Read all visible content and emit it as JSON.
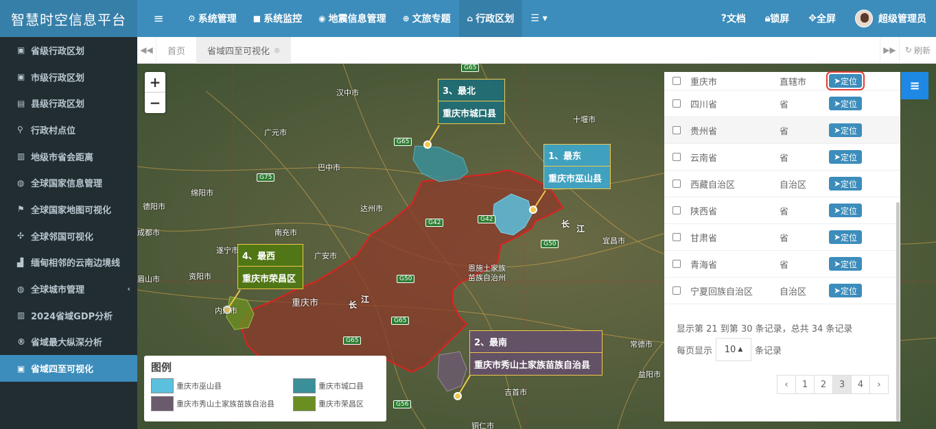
{
  "app": {
    "title": "智慧时空信息平台"
  },
  "topnav": {
    "menu_icon": "hamburger-icon",
    "items": [
      {
        "label": "系统管理",
        "icon": "gear-icon"
      },
      {
        "label": "系统监控",
        "icon": "video-icon"
      },
      {
        "label": "地震信息管理",
        "icon": "location-icon"
      },
      {
        "label": "文旅专题",
        "icon": "globe-icon"
      },
      {
        "label": "行政区划",
        "icon": "bank-icon"
      }
    ],
    "more_icon": "list-icon"
  },
  "topright": {
    "docs": "文档",
    "lock": "锁屏",
    "fullscreen": "全屏",
    "user": "超级管理员"
  },
  "sidebar": {
    "items": [
      {
        "label": "省级行政区划",
        "icon": "map-frame-icon"
      },
      {
        "label": "市级行政区划",
        "icon": "map-frame-icon"
      },
      {
        "label": "县级行政区划",
        "icon": "map-icon"
      },
      {
        "label": "行政村点位",
        "icon": "pin-icon"
      },
      {
        "label": "地级市省会距离",
        "icon": "bar-chart-icon"
      },
      {
        "label": "全球国家信息管理",
        "icon": "globe-icon"
      },
      {
        "label": "全球国家地图可视化",
        "icon": "flag-icon"
      },
      {
        "label": "全球邻国可视化",
        "icon": "move-icon"
      },
      {
        "label": "缅甸相邻的云南边境线",
        "icon": "area-chart-icon"
      },
      {
        "label": "全球城市管理",
        "icon": "globe-icon"
      },
      {
        "label": "2024省域GDP分析",
        "icon": "bar-chart-icon"
      },
      {
        "label": "省域最大纵深分析",
        "icon": "registered-icon"
      },
      {
        "label": "省域四至可视化",
        "icon": "map-frame-icon"
      }
    ]
  },
  "tabs": {
    "home": "首页",
    "active": "省域四至可视化",
    "refresh": "刷新"
  },
  "callouts": [
    {
      "title": "3、最北",
      "name": "重庆市城口县"
    },
    {
      "title": "1、最东",
      "name": "重庆市巫山县"
    },
    {
      "title": "4、最西",
      "name": "重庆市荣昌区"
    },
    {
      "title": "2、最南",
      "name": "重庆市秀山土家族苗族自治县"
    }
  ],
  "legend": {
    "title": "图例",
    "items": [
      {
        "label": "重庆市巫山县",
        "color": "#5bc0de"
      },
      {
        "label": "重庆市城口县",
        "color": "#3a8f98"
      },
      {
        "label": "重庆市秀山土家族苗族自治县",
        "color": "#6b5a6e"
      },
      {
        "label": "重庆市荣昌区",
        "color": "#6b8e23"
      }
    ]
  },
  "map_labels": {
    "chongqing": "重庆市",
    "hanzhong": "汉中市",
    "guangyuan": "广元市",
    "bazhong": "巴中市",
    "dazhou": "达州市",
    "nanchong": "南充市",
    "chengdu": "成都市",
    "suining": "遂宁市",
    "guangan": "广安市",
    "deyang": "德阳市",
    "mianyang": "绵阳市",
    "meishan": "眉山市",
    "ziyang": "资阳市",
    "neijiang": "内江市",
    "shiyan": "十堰市",
    "yichang": "宜昌市",
    "enshi": "恩施土家族\n苗族自治州",
    "changde": "常德市",
    "yiyang": "益阳市",
    "jishou": "吉首市",
    "tongren": "铜仁市",
    "changjiang": "长",
    "jiang": "江"
  },
  "roads": [
    "G65",
    "G65",
    "G75",
    "G42",
    "G42",
    "G50",
    "G50",
    "G65",
    "G65",
    "G56"
  ],
  "panel": {
    "rows": [
      {
        "name": "重庆市",
        "type": "直辖市",
        "btn": "定位"
      },
      {
        "name": "四川省",
        "type": "省",
        "btn": "定位"
      },
      {
        "name": "贵州省",
        "type": "省",
        "btn": "定位"
      },
      {
        "name": "云南省",
        "type": "省",
        "btn": "定位"
      },
      {
        "name": "西藏自治区",
        "type": "自治区",
        "btn": "定位"
      },
      {
        "name": "陕西省",
        "type": "省",
        "btn": "定位"
      },
      {
        "name": "甘肃省",
        "type": "省",
        "btn": "定位"
      },
      {
        "name": "青海省",
        "type": "省",
        "btn": "定位"
      },
      {
        "name": "宁夏回族自治区",
        "type": "自治区",
        "btn": "定位"
      }
    ],
    "info": "显示第 21 到第 30 条记录，总共 34 条记录",
    "per_page_prefix": "每页显示",
    "per_page_value": "10",
    "per_page_suffix": "条记录",
    "pages": [
      "‹",
      "1",
      "2",
      "3",
      "4",
      "›"
    ],
    "active_page": "3"
  }
}
